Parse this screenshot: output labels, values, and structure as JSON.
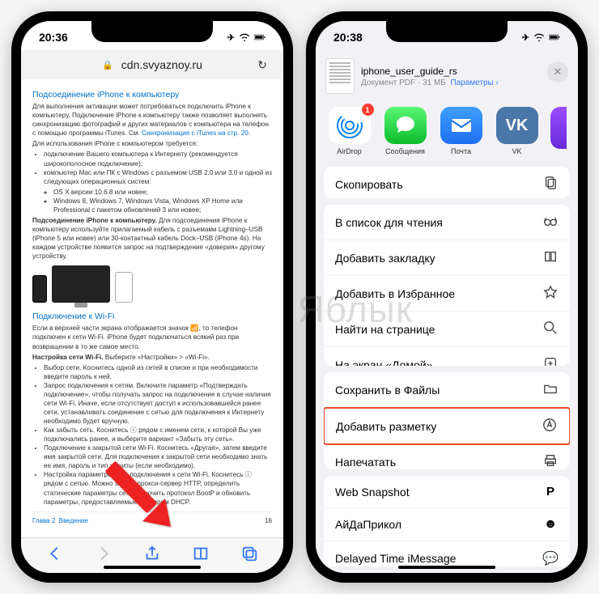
{
  "left": {
    "time": "20:36",
    "url_host": "cdn.svyaznoy.ru",
    "doc": {
      "h1": "Подсоединение iPhone к компьютеру",
      "p1": "Для выполнения активации может потребоваться подключить iPhone к компьютеру. Подключение iPhone к компьютеру также позволяет выполнять синхронизацию фотографий и других материалов с компьютера на телефон с помощью программы iTunes. См.",
      "link1": "Синхронизация с iTunes на стр. 20",
      "p2": "Для использования iPhone c компьютером требуется:",
      "b1": "подключение Вашего компьютера к Интернету (рекомендуется широкополосное подключение);",
      "b2": "компьютер Mac или ПК с Windows с разъемом USB 2.0 или 3.0 и одной из следующих операционных систем:",
      "b2a": "OS X версии 10.6.8 или новее;",
      "b2b": "Windows 8, Windows 7, Windows Vista, Windows XP Home или Professional с пакетом обновлений 3 или новее;",
      "p3a": "Подсоединение iPhone к компьютеру.",
      "p3b": " Для подсоединения iPhone к компьютеру используйте прилагаемый кабель с разъемами Lightning–USB (iPhone 5 или новее) или 30-контактный кабель Dock–USB (iPhone 4s). На каждом устройстве появится запрос на подтверждение «доверия» другому устройству.",
      "h2": "Подключение к Wi-Fi",
      "p4": "Если в верхней части экрана отображается значок 📶, то телефон подключен к сети Wi-Fi. iPhone будет подключаться всякий раз при возвращении в то же самое место.",
      "p5a": "Настройка сети Wi-Fi.",
      "p5b": " Выберите «Настройки» > «Wi-Fi».",
      "c1": "Выбор сети. Коснитесь одной из сетей в списке и при необходимости введите пароль к ней.",
      "c2": "Запрос подключения к сетям. Включите параметр «Подтверждать подключение», чтобы получать запрос на подключение в случае наличия сети Wi-Fi. Иначе, если отсутствует доступ к использовавшейся ранее сети, устанавливать соединение с сетью для подключения к Интернету необходимо будет вручную.",
      "c3": "Как забыть сеть. Коснитесь ⓘ рядом с именем сети, к которой Вы уже подключались ранее, и выберите вариант «Забыть эту сеть».",
      "c4": "Подключение к закрытой сети Wi-Fi. Коснитесь «Другая», затем введите имя закрытой сети. Для подключения к закрытой сети необходимо знать ее имя, пароль и тип защиты (если необходимо).",
      "c5": "Настройка параметров для подключения к сети Wi-Fi. Коснитесь ⓘ рядом с сетью. Можно задать прокси-сервер HTTP, определить статические параметры сети, включить протокол BootP и обновить параметры, предоставляемые сервером DHCP.",
      "footer_chapter": "Глава 2",
      "footer_section": "Введение",
      "footer_page": "16"
    }
  },
  "right": {
    "time": "20:38",
    "file_title": "iphone_user_guide_rs",
    "file_sub_type": "Документ PDF",
    "file_sub_size": "31 МБ",
    "file_sub_opts": "Параметры",
    "apps": {
      "airdrop": "AirDrop",
      "badge": "1",
      "messages": "Сообщения",
      "mail": "Почта",
      "vk": "VK"
    },
    "actions": {
      "copy": "Скопировать",
      "reading_list": "В список для чтения",
      "bookmark": "Добавить закладку",
      "favorite": "Добавить в Избранное",
      "find": "Найти на странице",
      "homescreen": "На экран «Домой»",
      "save_files": "Сохранить в Файлы",
      "markup": "Добавить разметку",
      "print": "Напечатать",
      "websnap": "Web Snapshot",
      "aida": "АйДаПрикол",
      "delayed": "Delayed Time iMessage"
    }
  },
  "watermark": "Яблык"
}
